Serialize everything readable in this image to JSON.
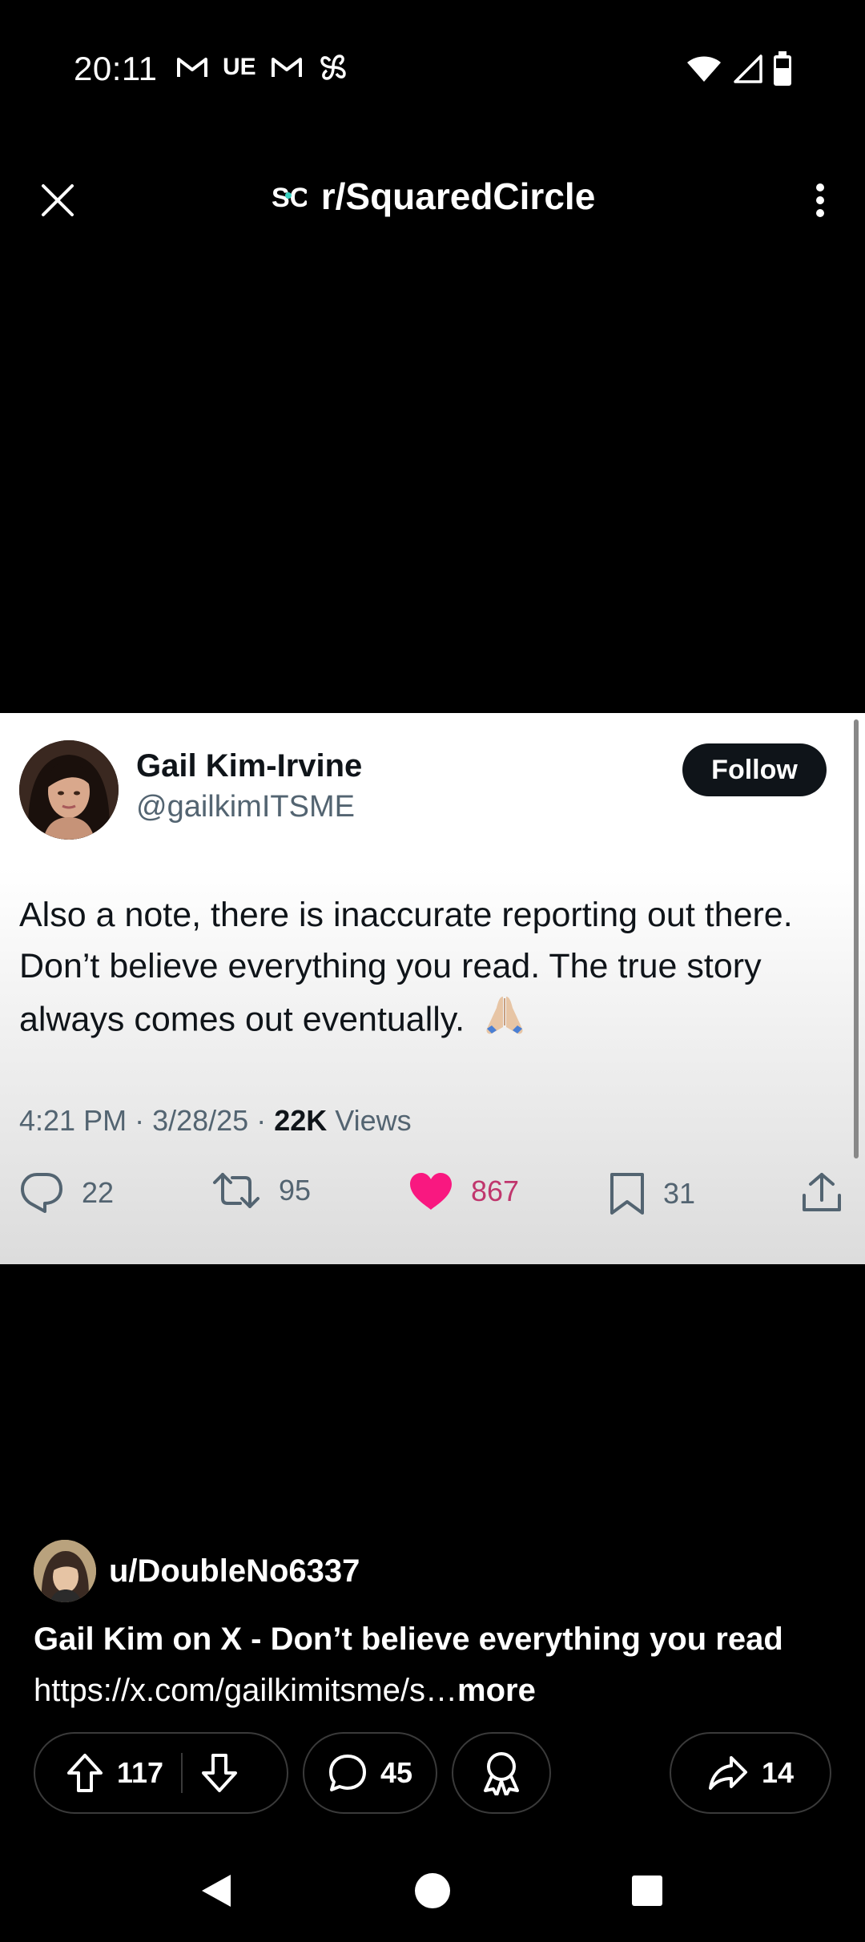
{
  "status_bar": {
    "time": "20:11",
    "notification_icons": [
      "gmail-icon",
      "ue-icon",
      "gmail-icon",
      "pinwheel-icon"
    ],
    "ue_label": "UE",
    "system_icons": [
      "wifi-icon",
      "cellular-signal-icon",
      "battery-icon"
    ]
  },
  "header": {
    "subreddit": "r/SquaredCircle",
    "close_icon": "close-icon",
    "overflow_icon": "more-vertical-icon"
  },
  "tweet": {
    "display_name": "Gail Kim-Irvine",
    "handle": "@gailkimITSME",
    "follow_label": "Follow",
    "text": "Also a note, there is inaccurate reporting out there.  Don’t believe everything you read.  The true story always comes out eventually.",
    "emoji": "folded-hands-emoji",
    "time": "4:21 PM",
    "date": "3/28/25",
    "views_count": "22K",
    "views_label": "Views",
    "replies": "22",
    "reposts": "95",
    "likes": "867",
    "bookmarks": "31",
    "like_color": "#f91880"
  },
  "post": {
    "username": "u/DoubleNo6337",
    "title": "Gail Kim on X - Don’t believe everything you read",
    "link_text": "https://x.com/gailkimitsme/s…",
    "more_label": "more",
    "upvotes": "117",
    "comments": "45",
    "shares": "14"
  },
  "nav": {
    "buttons": [
      "back-icon",
      "home-icon",
      "recents-icon"
    ]
  }
}
